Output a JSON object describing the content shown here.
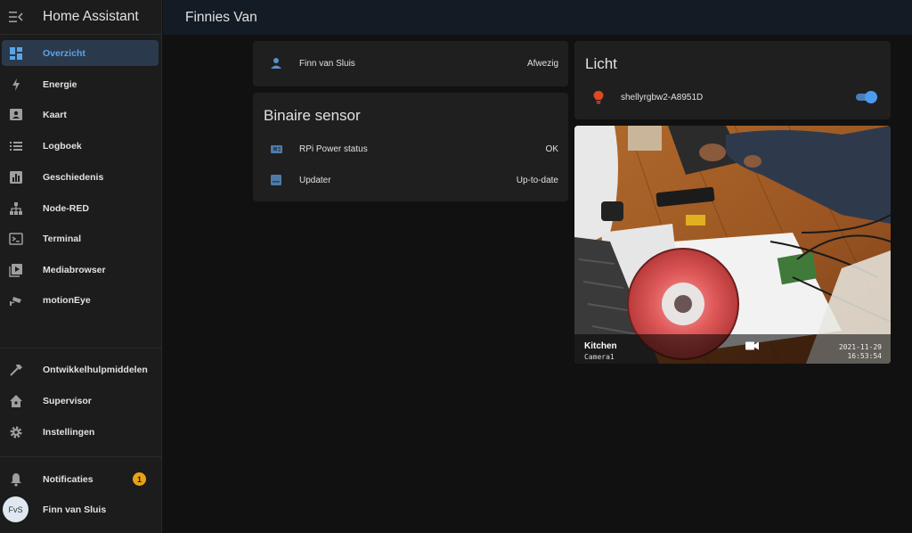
{
  "app": {
    "title": "Home Assistant"
  },
  "header": {
    "title": "Finnies Van"
  },
  "sidebar": {
    "items": [
      {
        "label": "Overzicht",
        "icon": "dashboard-icon",
        "active": true
      },
      {
        "label": "Energie",
        "icon": "lightning-icon"
      },
      {
        "label": "Kaart",
        "icon": "map-account-icon"
      },
      {
        "label": "Logboek",
        "icon": "list-icon"
      },
      {
        "label": "Geschiedenis",
        "icon": "chart-box-icon"
      },
      {
        "label": "Node-RED",
        "icon": "sitemap-icon"
      },
      {
        "label": "Terminal",
        "icon": "console-icon"
      },
      {
        "label": "Mediabrowser",
        "icon": "play-box-icon"
      },
      {
        "label": "motionEye",
        "icon": "cctv-icon"
      }
    ],
    "tools": [
      {
        "label": "Ontwikkelhulpmiddelen",
        "icon": "hammer-icon"
      },
      {
        "label": "Supervisor",
        "icon": "home-assistant-icon"
      },
      {
        "label": "Instellingen",
        "icon": "cog-icon"
      }
    ],
    "notifications": {
      "label": "Notificaties",
      "count": "1"
    },
    "user": {
      "name": "Finn van Sluis",
      "initials": "FvS"
    }
  },
  "cards": {
    "person": {
      "name": "Finn van Sluis",
      "state": "Afwezig"
    },
    "binary_sensor": {
      "title": "Binaire sensor",
      "rows": [
        {
          "name": "RPi Power status",
          "state": "OK",
          "icon": "raspberry-pi-icon"
        },
        {
          "name": "Updater",
          "state": "Up-to-date",
          "icon": "package-icon"
        }
      ]
    },
    "light": {
      "title": "Licht",
      "entity": "shellyrgbw2-A8951D",
      "state": "on",
      "icon": "lightbulb-icon",
      "color": "#e04820"
    },
    "camera": {
      "name": "Kitchen",
      "sub": "Camera1",
      "date": "2021-11-29",
      "time": "16:53:54",
      "icon": "video-icon"
    }
  },
  "colors": {
    "accent": "#5ba4e8",
    "badge": "#e8a317"
  }
}
